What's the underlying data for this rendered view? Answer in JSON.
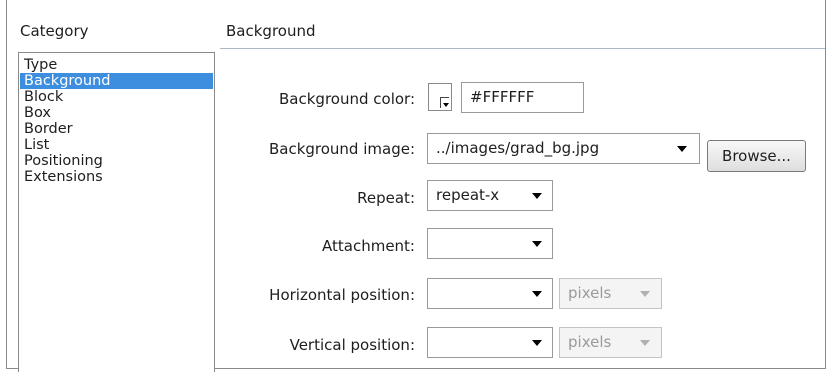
{
  "headers": {
    "category": "Category",
    "section": "Background"
  },
  "categories": [
    {
      "label": "Type"
    },
    {
      "label": "Background",
      "selected": true
    },
    {
      "label": "Block"
    },
    {
      "label": "Box"
    },
    {
      "label": "Border"
    },
    {
      "label": "List"
    },
    {
      "label": "Positioning"
    },
    {
      "label": "Extensions"
    }
  ],
  "fields": {
    "bg_color": {
      "label": "Background color:",
      "value": "#FFFFFF"
    },
    "bg_image": {
      "label": "Background image:",
      "value": "../images/grad_bg.jpg",
      "button": "Browse..."
    },
    "repeat": {
      "label": "Repeat:",
      "value": "repeat-x"
    },
    "attachment": {
      "label": "Attachment:",
      "value": ""
    },
    "h_position": {
      "label": "Horizontal position:",
      "value": "",
      "unit": "pixels"
    },
    "v_position": {
      "label": "Vertical position:",
      "value": "",
      "unit": "pixels"
    }
  },
  "colors": {
    "selection": "#3d8ede",
    "swatch": "#FFFFFF"
  }
}
